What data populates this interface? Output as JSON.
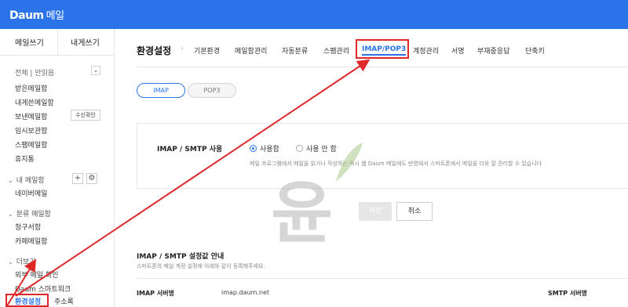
{
  "header": {
    "logo": "Daum",
    "service": "메일"
  },
  "sidebar": {
    "compose_label": "메일쓰기",
    "self_label": "내게쓰기",
    "filter_label": "전체 | 안읽음",
    "folders": [
      "받은메일함",
      "내게쓴메일함",
      "보낸메일함",
      "임시보관함",
      "스팸메일함",
      "휴지통"
    ],
    "receipt_label": "수신확인",
    "my_folders_label": "내 메일함",
    "my_folders": [
      "네이버메일"
    ],
    "category_label": "분류 메일함",
    "categories": [
      "청구서함",
      "카페메일함"
    ],
    "more_label": "더보기",
    "more_items": [
      "외부 메일 확인",
      "Daum 스마트워크",
      "환경설정",
      "주소록"
    ]
  },
  "main": {
    "title": "환경설정",
    "tabs": [
      "기본환경",
      "메일함관리",
      "자동분류",
      "스팸관리",
      "IMAP/POP3",
      "계정관리",
      "서명",
      "부재중응답",
      "단축키"
    ],
    "subtabs": [
      "IMAP",
      "POP3"
    ],
    "panel": {
      "label": "IMAP / SMTP 사용",
      "option_on": "사용함",
      "option_off": "사용 안 함",
      "description": "메일 프로그램에서 메일을 읽거나 작성하는 즉시 웹 Daum 메일에도 반영돼서 스마트폰에서 메일을 더욱 잘 관리할 수 있습니다"
    },
    "save_label": "저장",
    "cancel_label": "취소",
    "settings": {
      "title": "IMAP / SMTP 설정값 안내",
      "desc": "스마트폰의 메일 계정 설정에 아래와 같이 등록해주세요.",
      "imap_label": "IMAP 서버명",
      "imap_value": "imap.daum.net",
      "smtp_label": "SMTP 서버명"
    }
  },
  "watermark": {
    "text": "윤"
  },
  "colors": {
    "brand": "#2a73e8",
    "annotation": "#e0282a"
  }
}
